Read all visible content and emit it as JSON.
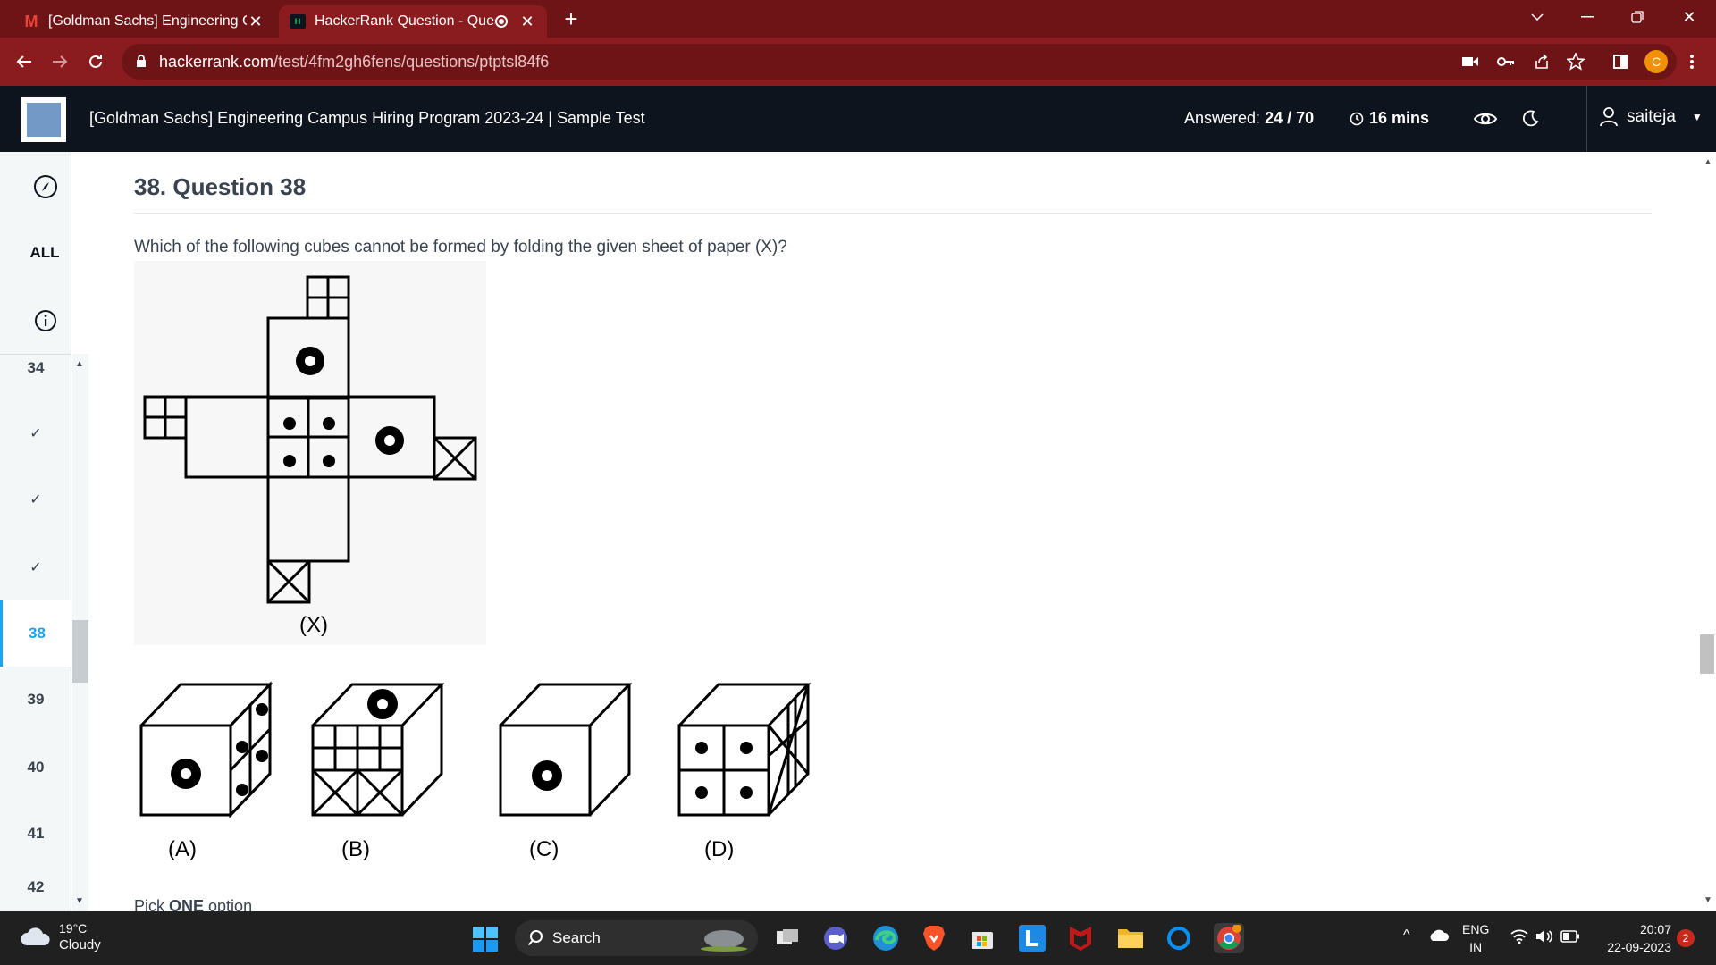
{
  "browser": {
    "tabs": [
      {
        "title": "[Goldman Sachs] Engineering Ca",
        "active": false
      },
      {
        "title": "HackerRank Question - Ques",
        "active": true
      }
    ],
    "url_host": "hackerrank.com",
    "url_path": "/test/4fm2gh6fens/questions/ptptsl84f6",
    "profile_initial": "C",
    "new_tab": "+"
  },
  "header": {
    "title": "[Goldman Sachs] Engineering Campus Hiring Program 2023-24 | Sample Test",
    "answered_label": "Answered:",
    "answered_value": "24 / 70",
    "timer": "16 mins",
    "username": "saiteja"
  },
  "sidebar": {
    "all_label": "ALL",
    "questions": [
      {
        "label": "34",
        "state": "number"
      },
      {
        "label": "✓",
        "state": "answered"
      },
      {
        "label": "✓",
        "state": "answered"
      },
      {
        "label": "✓",
        "state": "answered"
      },
      {
        "label": "38",
        "state": "current"
      },
      {
        "label": "39",
        "state": "number"
      },
      {
        "label": "40",
        "state": "number"
      },
      {
        "label": "41",
        "state": "number"
      },
      {
        "label": "42",
        "state": "number"
      }
    ]
  },
  "question": {
    "title": "38. Question 38",
    "text": "Which of the following cubes cannot be formed by folding the given sheet of paper (X)?",
    "figure_label": "(X)",
    "option_labels": [
      "(A)",
      "(B)",
      "(C)",
      "(D)"
    ],
    "pick_prefix": "Pick ",
    "pick_bold": "ONE",
    "pick_suffix": " option"
  },
  "taskbar": {
    "temperature": "19°C",
    "condition": "Cloudy",
    "search_label": "Search",
    "lang_top": "ENG",
    "lang_bottom": "IN",
    "time": "20:07",
    "date": "22-09-2023",
    "notification_count": "2"
  }
}
